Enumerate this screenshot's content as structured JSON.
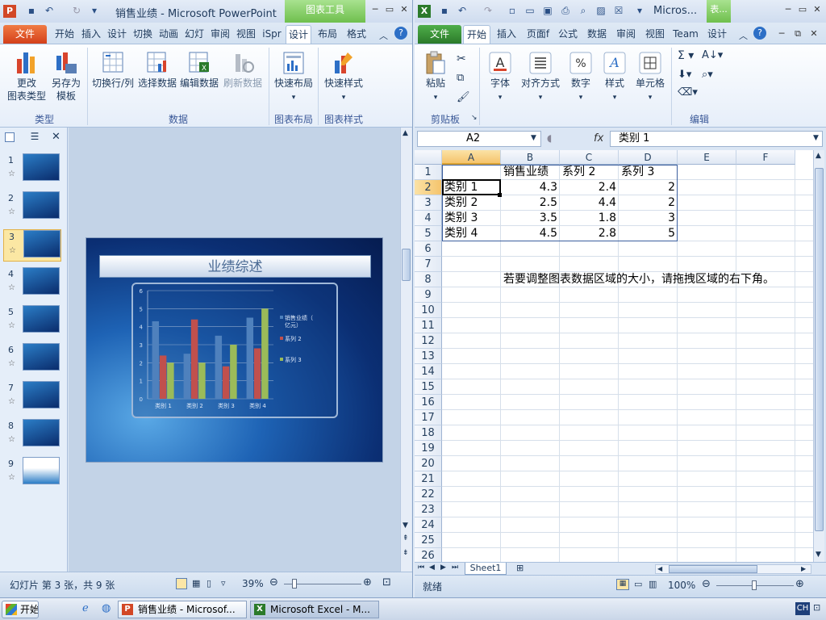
{
  "ppt": {
    "title": "销售业绩 - Microsoft PowerPoint",
    "context_tab": "图表工具",
    "app_icon": "P",
    "tabs": [
      "文件",
      "开始",
      "插入",
      "设计",
      "切换",
      "动画",
      "幻灯",
      "审阅",
      "视图",
      "iSpr",
      "设计",
      "布局",
      "格式"
    ],
    "ribbon": {
      "change_type": "更改\n图表类型",
      "change_type_l1": "更改",
      "change_type_l2": "图表类型",
      "save_template_l1": "另存为",
      "save_template_l2": "模板",
      "switch_row_col": "切换行/列",
      "select_data": "选择数据",
      "edit_data": "编辑数据",
      "refresh_data": "刷新数据",
      "quick_layout": "快速布局",
      "quick_style": "快速样式",
      "group_type": "类型",
      "group_data": "数据",
      "group_layout": "图表布局",
      "group_style": "图表样式"
    },
    "slide_numbers": [
      "1",
      "2",
      "3",
      "4",
      "5",
      "6",
      "7",
      "8",
      "9"
    ],
    "slide_title": "业绩综述",
    "status_text": "幻灯片 第 3 张，共 9 张",
    "zoom": "39%"
  },
  "chart_data": {
    "type": "bar",
    "categories": [
      "类别 1",
      "类别 2",
      "类别 3",
      "类别 4"
    ],
    "series": [
      {
        "name": "销售业绩（亿元）",
        "values": [
          4.3,
          2.5,
          3.5,
          4.5
        ],
        "color": "#4f81bd"
      },
      {
        "name": "系列 2",
        "values": [
          2.4,
          4.4,
          1.8,
          2.8
        ],
        "color": "#c0504d"
      },
      {
        "name": "系列 3",
        "values": [
          2,
          2,
          3,
          5
        ],
        "color": "#9bbb59"
      }
    ],
    "y_ticks": [
      "0",
      "1",
      "2",
      "3",
      "4",
      "5",
      "6"
    ],
    "ylim": [
      0,
      6
    ],
    "legend_position": "right"
  },
  "excel": {
    "title": "Micros...",
    "context_tab": "表...",
    "app_icon": "X",
    "tabs": [
      "文件",
      "开始",
      "插入",
      "页面f",
      "公式",
      "数据",
      "审阅",
      "视图",
      "Team",
      "设计"
    ],
    "ribbon": {
      "paste": "粘贴",
      "font": "字体",
      "align": "对齐方式",
      "number": "数字",
      "style": "样式",
      "cells": "单元格",
      "group_clipboard": "剪贴板",
      "group_edit": "编辑"
    },
    "name_box": "A2",
    "fx": "fx",
    "formula": "类别 1",
    "columns": [
      "A",
      "B",
      "C",
      "D",
      "E",
      "F"
    ],
    "rows": [
      "1",
      "2",
      "3",
      "4",
      "5",
      "6",
      "7",
      "8",
      "9",
      "10",
      "11",
      "12",
      "13",
      "14",
      "15",
      "16",
      "17",
      "18",
      "19",
      "20",
      "21",
      "22",
      "23",
      "24",
      "25",
      "26"
    ],
    "header_row": [
      "",
      "销售业绩",
      "系列 2",
      "系列 3"
    ],
    "data_rows": [
      [
        "类别 1",
        "4.3",
        "2.4",
        "2"
      ],
      [
        "类别 2",
        "2.5",
        "4.4",
        "2"
      ],
      [
        "类别 3",
        "3.5",
        "1.8",
        "3"
      ],
      [
        "类别 4",
        "4.5",
        "2.8",
        "5"
      ]
    ],
    "note": "若要调整图表数据区域的大小，请拖拽区域的右下角。",
    "sheet_tab": "Sheet1",
    "status_text": "就绪",
    "zoom": "100%"
  },
  "taskbar": {
    "start": "开始",
    "ppt_button": "销售业绩 - Microsof...",
    "excel_button": "Microsoft Excel - M...",
    "ime": "CH"
  }
}
